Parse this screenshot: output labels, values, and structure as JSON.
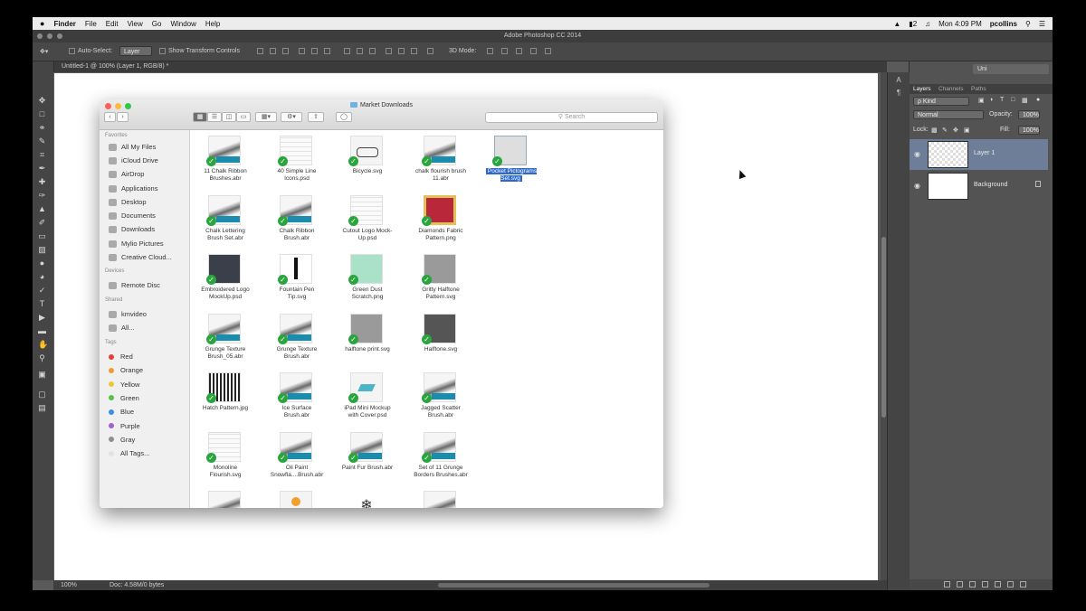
{
  "menubar": {
    "apple": "",
    "items": [
      "Finder",
      "File",
      "Edit",
      "View",
      "Go",
      "Window",
      "Help"
    ],
    "battery": "2",
    "clock": "Mon 4:09 PM",
    "user": "pcollins"
  },
  "app": {
    "title": "Adobe Photoshop CC 2014",
    "options": {
      "auto_select_label": "Auto-Select:",
      "auto_select_value": "Layer",
      "transform_label": "Show Transform Controls",
      "mode_label": "3D Mode:",
      "workspace": "Uni"
    },
    "doc_tab": "Untitled-1 @ 100% (Layer 1, RGB/8) *",
    "status": {
      "zoom": "100%",
      "doc": "Doc: 4.58M/0 bytes"
    }
  },
  "layers_panel": {
    "tabs": [
      "Layers",
      "Channels",
      "Paths"
    ],
    "filter": "ρ Kind",
    "blend_mode": "Normal",
    "opacity_label": "Opacity:",
    "opacity_value": "100%",
    "lock_label": "Lock:",
    "fill_label": "Fill:",
    "fill_value": "100%",
    "layers": [
      {
        "name": "Layer 1",
        "selected": true
      },
      {
        "name": "Background",
        "selected": false
      }
    ]
  },
  "finder": {
    "title": "Market Downloads",
    "search_placeholder": "Search",
    "sidebar": {
      "favorites_header": "Favorites",
      "favorites": [
        "All My Files",
        "iCloud Drive",
        "AirDrop",
        "Applications",
        "Desktop",
        "Documents",
        "Downloads",
        "Mylio Pictures",
        "Creative Cloud..."
      ],
      "devices_header": "Devices",
      "devices": [
        "Remote Disc"
      ],
      "shared_header": "Shared",
      "shared": [
        "kmvideo",
        "All..."
      ],
      "tags_header": "Tags",
      "tags": [
        {
          "name": "Red",
          "color": "#e0433c"
        },
        {
          "name": "Orange",
          "color": "#f09a36"
        },
        {
          "name": "Yellow",
          "color": "#e8c93a"
        },
        {
          "name": "Green",
          "color": "#5cc046"
        },
        {
          "name": "Blue",
          "color": "#3c8fe0"
        },
        {
          "name": "Purple",
          "color": "#a25fcf"
        },
        {
          "name": "Gray",
          "color": "#8e8e8e"
        },
        {
          "name": "All Tags...",
          "color": "#e2e2e2"
        }
      ]
    },
    "files": [
      {
        "name": "11 Chalk Ribbon\nBrushes.abr",
        "icon": "brush"
      },
      {
        "name": "40 Simple Line\nIcons.psd",
        "icon": "lines"
      },
      {
        "name": "Bicycle.svg",
        "icon": "bike"
      },
      {
        "name": "chalk flourish brush\n11.abr",
        "icon": "brush"
      },
      {
        "name": "Pocket Pictograms\nSet.svg",
        "icon": "lines",
        "selected": true
      },
      {
        "name": "Chalk Lettering\nBrush Set.abr",
        "icon": "brush"
      },
      {
        "name": "Chalk Ribbon\nBrush.abr",
        "icon": "brush"
      },
      {
        "name": "Cutout Logo Mock-\nUp.psd",
        "icon": "lines"
      },
      {
        "name": "Diamonds Fabric\nPattern.png",
        "icon": "red"
      },
      {
        "name": "Embroidered Logo\nMockUp.psd",
        "icon": "dark"
      },
      {
        "name": "Fountain Pen\nTip.svg",
        "icon": "pen"
      },
      {
        "name": "Green Dust\nScratch.png",
        "icon": "green"
      },
      {
        "name": "Gritty Halftone\nPattern.svg",
        "icon": "gray"
      },
      {
        "name": "Grunge Texture\nBrush_05.abr",
        "icon": "brush"
      },
      {
        "name": "Grunge Texture\nBrush.abr",
        "icon": "brush"
      },
      {
        "name": "halftone print.svg",
        "icon": "gray"
      },
      {
        "name": "Halftone.svg",
        "icon": "dgray"
      },
      {
        "name": "Hatch Pattern.jpg",
        "icon": "qr"
      },
      {
        "name": "Ice Surface\nBrush.abr",
        "icon": "brush"
      },
      {
        "name": "iPad Mini Mockup\nwith Cover.psd",
        "icon": "ipad"
      },
      {
        "name": "Jagged Scatter\nBrush.abr",
        "icon": "brush"
      },
      {
        "name": "Monoline\nFlourish.svg",
        "icon": "lines"
      },
      {
        "name": "Oil Paint\nSnowfla....Brush.abr",
        "icon": "brush"
      },
      {
        "name": "Paint Fur Brush.abr",
        "icon": "brush"
      },
      {
        "name": "Set of 11 Grunge\nBorders Brushes.abr",
        "icon": "brush"
      },
      {
        "name": "",
        "icon": "brush",
        "nocheck": true
      },
      {
        "name": "",
        "icon": "orange",
        "nocheck": true
      },
      {
        "name": "",
        "icon": "snow",
        "nocheck": true
      },
      {
        "name": "",
        "icon": "brush",
        "nocheck": true
      }
    ]
  }
}
